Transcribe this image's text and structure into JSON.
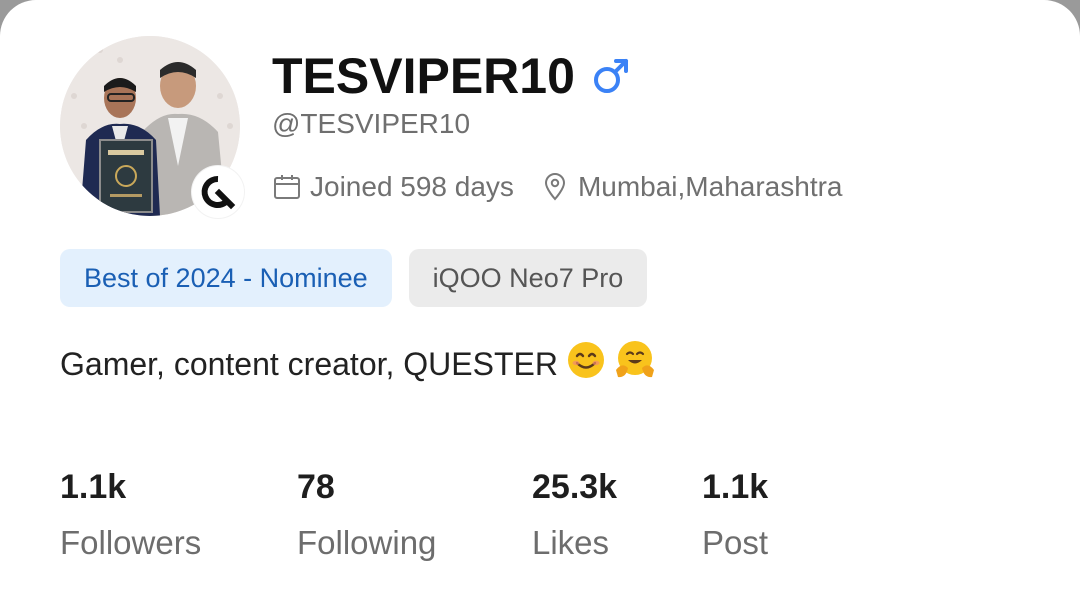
{
  "profile": {
    "display_name": "TESVIPER10",
    "handle": "@TESVIPER10",
    "gender_icon": "male-symbol-icon",
    "joined": "Joined 598 days",
    "location": "Mumbai,Maharashtra",
    "avatar_badge_icon": "quest-logo-icon"
  },
  "chips": [
    {
      "label": "Best of 2024 - Nominee"
    },
    {
      "label": "iQOO Neo7 Pro"
    }
  ],
  "bio": {
    "text": "Gamer, content creator, QUESTER",
    "emojis": [
      "smiling-face-emoji",
      "hugging-face-emoji"
    ]
  },
  "stats": [
    {
      "value": "1.1k",
      "label": "Followers"
    },
    {
      "value": "78",
      "label": "Following"
    },
    {
      "value": "25.3k",
      "label": "Likes"
    },
    {
      "value": "1.1k",
      "label": "Post"
    }
  ],
  "colors": {
    "accent_blue": "#3b82f6",
    "chip_blue_bg": "#e3f0fd",
    "chip_blue_text": "#1a5fb4",
    "chip_gray_bg": "#ebebeb"
  }
}
